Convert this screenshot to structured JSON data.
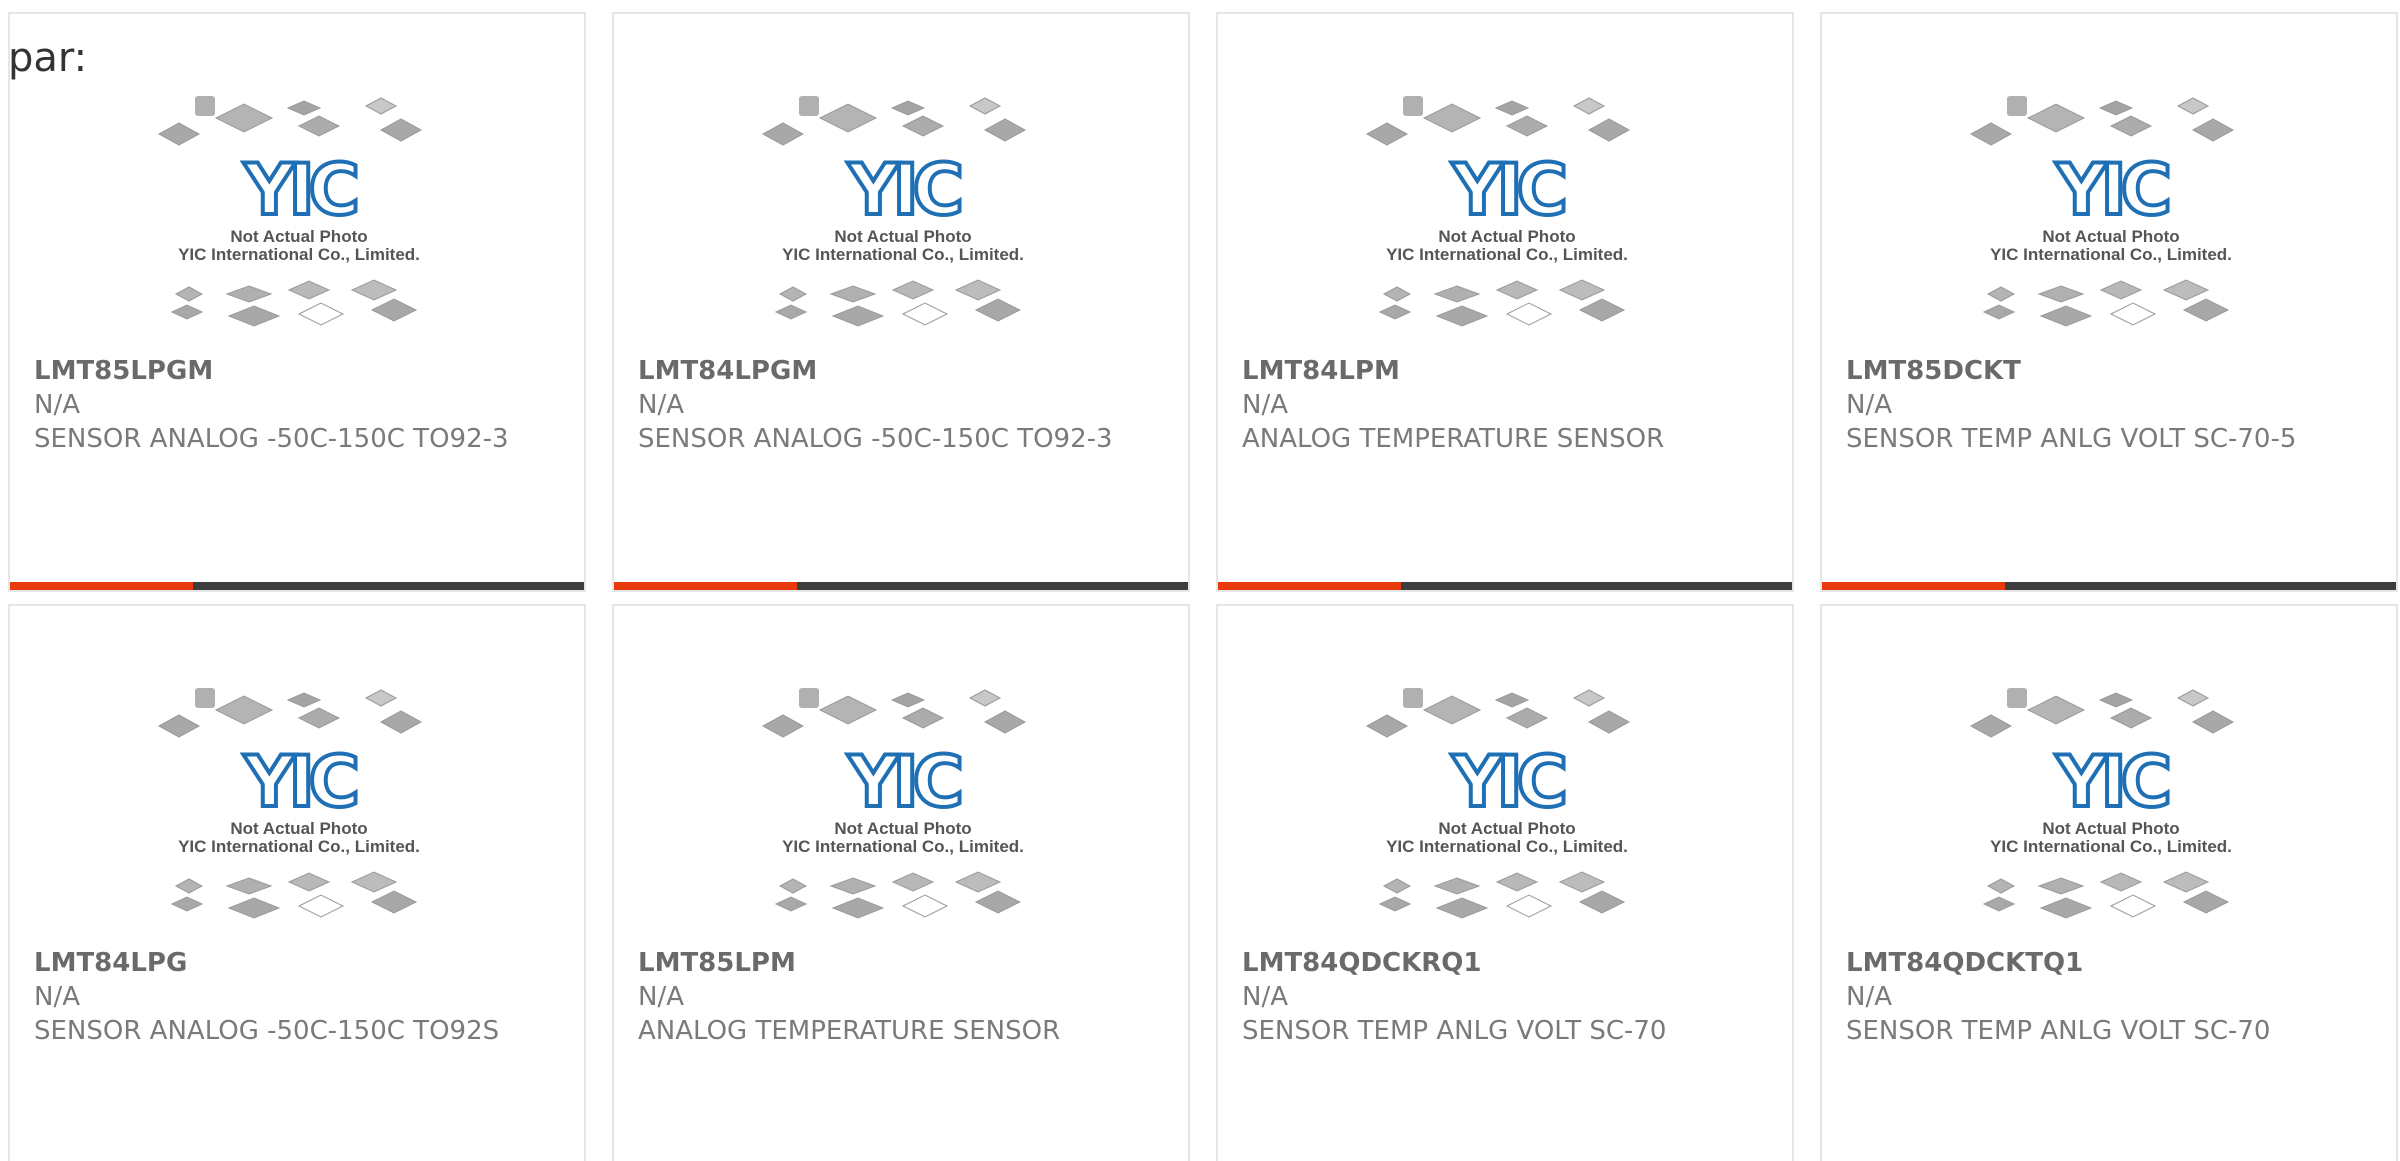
{
  "page": {
    "label": "par:"
  },
  "placeholder_image": {
    "caption_line1": "Not Actual Photo",
    "caption_line2": "YIC International Co., Limited.",
    "logo_text": "YIC",
    "logo_color": "#1f6fb5"
  },
  "accent_colors": {
    "bar_active": "#e8380d",
    "bar_track": "#3d3d3d"
  },
  "products": [
    {
      "part_number": "LMT85LPGM",
      "manufacturer": "N/A",
      "description": "SENSOR ANALOG -50C-150C TO92-3"
    },
    {
      "part_number": "LMT84LPGM",
      "manufacturer": "N/A",
      "description": "SENSOR ANALOG -50C-150C TO92-3"
    },
    {
      "part_number": "LMT84LPM",
      "manufacturer": "N/A",
      "description": "ANALOG TEMPERATURE SENSOR"
    },
    {
      "part_number": "LMT85DCKT",
      "manufacturer": "N/A",
      "description": "SENSOR TEMP ANLG VOLT SC-70-5"
    },
    {
      "part_number": "LMT84LPG",
      "manufacturer": "N/A",
      "description": "SENSOR ANALOG -50C-150C TO92S"
    },
    {
      "part_number": "LMT85LPM",
      "manufacturer": "N/A",
      "description": "ANALOG TEMPERATURE SENSOR"
    },
    {
      "part_number": "LMT84QDCKRQ1",
      "manufacturer": "N/A",
      "description": "SENSOR TEMP ANLG VOLT SC-70"
    },
    {
      "part_number": "LMT84QDCKTQ1",
      "manufacturer": "N/A",
      "description": "SENSOR TEMP ANLG VOLT SC-70"
    }
  ]
}
